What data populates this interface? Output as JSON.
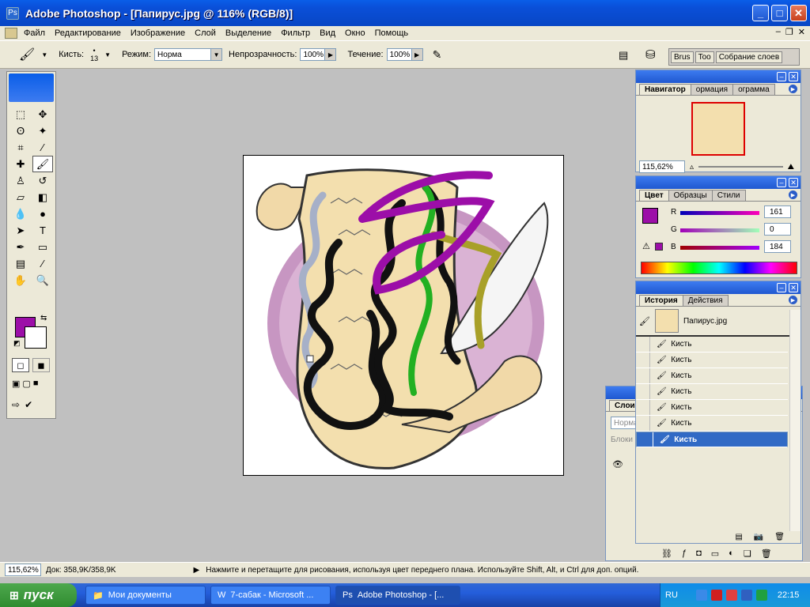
{
  "window": {
    "title": "Adobe Photoshop - [Папирус.jpg @ 116% (RGB/8)]"
  },
  "menu": [
    "Файл",
    "Редактирование",
    "Изображение",
    "Слой",
    "Выделение",
    "Фильтр",
    "Вид",
    "Окно",
    "Помощь"
  ],
  "options": {
    "brush_label": "Кисть:",
    "brush_size": "13",
    "mode_label": "Режим:",
    "mode_value": "Норма",
    "opacity_label": "Непрозрачность:",
    "opacity_value": "100%",
    "flow_label": "Течение:",
    "flow_value": "100%"
  },
  "palette_well": [
    "Brus",
    "Too",
    "Собрание слоев"
  ],
  "colors": {
    "foreground": "#9c0ea8",
    "background": "#ffffff"
  },
  "navigator": {
    "tabs": [
      "Навигатор",
      "ормация",
      "ограмма"
    ],
    "zoom": "115,62%"
  },
  "color_panel": {
    "tabs": [
      "Цвет",
      "Образцы",
      "Стили"
    ],
    "r_label": "R",
    "r": "161",
    "g_label": "G",
    "g": "0",
    "b_label": "B",
    "b": "184"
  },
  "history": {
    "tabs": [
      "История",
      "Действия"
    ],
    "snapshot": "Папирус.jpg",
    "items": [
      "Кисть",
      "Кисть",
      "Кисть",
      "Кисть",
      "Кисть",
      "Кисть",
      "Кисть"
    ]
  },
  "layers_panel": {
    "title": "Слои",
    "blend": "Норма",
    "lock": "Блоки"
  },
  "status": {
    "zoom": "115,62%",
    "doc": "Док: 358,9K/358,9K",
    "hint": "Нажмите и перетащите для рисования, используя цвет переднего плана. Используйте Shift, Alt, и Ctrl для доп. опций."
  },
  "taskbar": {
    "start": "пуск",
    "buttons": [
      "Мои документы",
      "7-сабак - Microsoft ...",
      "Adobe Photoshop - [..."
    ],
    "lang": "RU",
    "clock": "22:15"
  }
}
